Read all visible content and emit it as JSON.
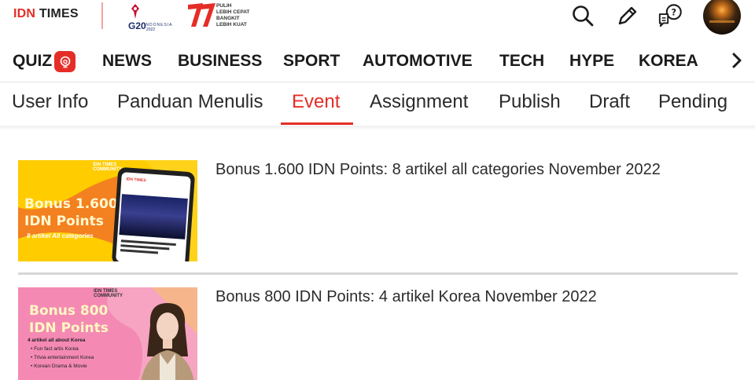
{
  "header": {
    "brand_prefix": "IDN",
    "brand_suffix": "TIMES",
    "g20_label": "G20",
    "g20_sub": "INDONESIA",
    "g20_year": "2022",
    "anniversary_slogan": [
      "PULIH",
      "LEBIH CEPAT",
      "BANGKIT",
      "LEBIH KUAT"
    ],
    "icons": [
      "search-icon",
      "pencil-icon",
      "question-chat-icon",
      "avatar"
    ]
  },
  "categories": {
    "items": [
      "QUIZ",
      "NEWS",
      "BUSINESS",
      "SPORT",
      "AUTOMOTIVE",
      "TECH",
      "HYPE",
      "KOREA"
    ],
    "more_icon": "chevron-right-icon"
  },
  "tabs": {
    "items": [
      "User Info",
      "Panduan Menulis",
      "Event",
      "Assignment",
      "Publish",
      "Draft",
      "Pending"
    ],
    "active": "Event"
  },
  "events": [
    {
      "title": "Bonus 1.600 IDN Points: 8 artikel all categories November 2022",
      "thumb": {
        "header": [
          "IDN TIMES",
          "COMMUNITY"
        ],
        "line1": "Bonus 1.600",
        "line2": "IDN Points",
        "line3": "8 artikel All categories"
      }
    },
    {
      "title": "Bonus 800 IDN Points: 4 artikel Korea November 2022",
      "thumb": {
        "header": [
          "IDN TIMES",
          "COMMUNITY"
        ],
        "line1": "Bonus 800",
        "line2": "IDN Points",
        "line3": "4 artikel all about Korea",
        "bullets": [
          "• Fun fact artis Korea",
          "• Trivia entertainment Korea",
          "• Korean Drama & Movie"
        ]
      }
    }
  ],
  "colors": {
    "accent": "#e52d27",
    "text": "#222222",
    "divider": "#d7d7d7"
  }
}
